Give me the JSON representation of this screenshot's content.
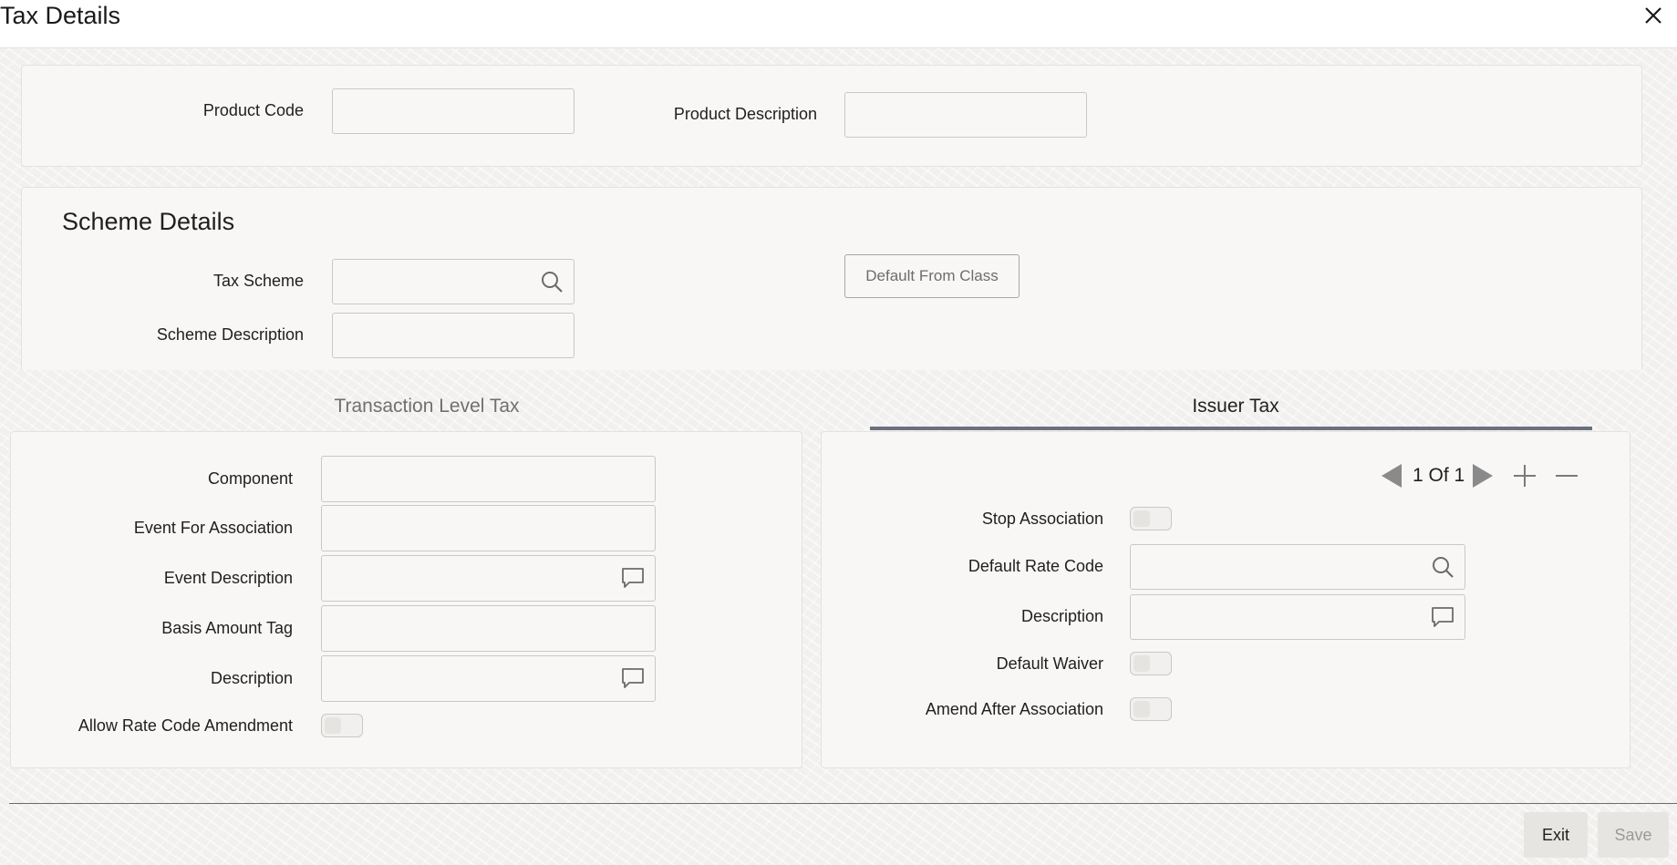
{
  "window": {
    "title": "Tax Details"
  },
  "product": {
    "code_label": "Product Code",
    "code_value": "",
    "description_label": "Product Description",
    "description_value": ""
  },
  "scheme": {
    "section_title": "Scheme Details",
    "tax_scheme_label": "Tax Scheme",
    "tax_scheme_value": "",
    "scheme_description_label": "Scheme Description",
    "scheme_description_value": "",
    "default_from_class_label": "Default From Class"
  },
  "tabs": [
    {
      "label": "Transaction Level Tax",
      "active": false
    },
    {
      "label": "Issuer Tax",
      "active": true
    }
  ],
  "transaction_tax": {
    "component_label": "Component",
    "component_value": "",
    "event_for_association_label": "Event For Association",
    "event_for_association_value": "",
    "event_description_label": "Event Description",
    "event_description_value": "",
    "basis_amount_tag_label": "Basis Amount Tag",
    "basis_amount_tag_value": "",
    "description_label": "Description",
    "description_value": "",
    "allow_rate_code_amendment_label": "Allow Rate Code Amendment",
    "allow_rate_code_amendment": false
  },
  "issuer_tax": {
    "pager": {
      "text": "1 Of 1",
      "current": 1,
      "total": 1
    },
    "stop_association_label": "Stop Association",
    "stop_association": false,
    "default_rate_code_label": "Default Rate Code",
    "default_rate_code_value": "",
    "description_label": "Description",
    "description_value": "",
    "default_waiver_label": "Default Waiver",
    "default_waiver": false,
    "amend_after_association_label": "Amend After Association",
    "amend_after_association": false
  },
  "footer": {
    "exit_label": "Exit",
    "save_label": "Save"
  },
  "colors": {
    "tab_underline": "#6a7080",
    "panel_bg": "#f8f7f5",
    "disabled_text": "#9a9a9a"
  }
}
